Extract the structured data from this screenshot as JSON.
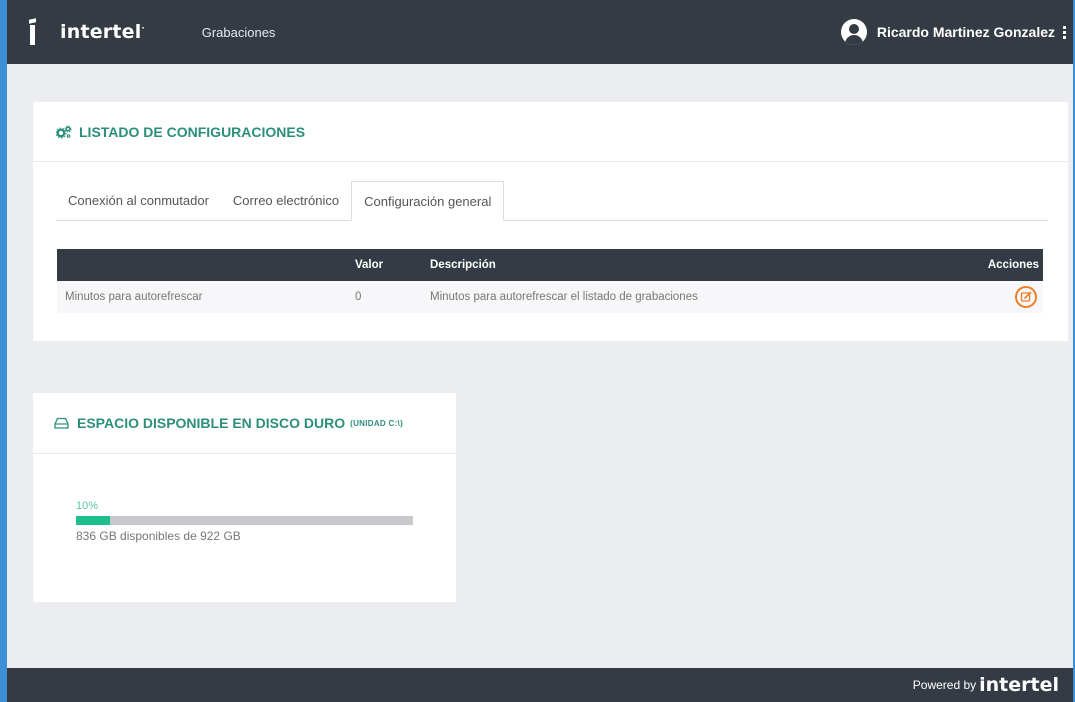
{
  "header": {
    "brand": "intertel",
    "nav_link": "Grabaciones",
    "user_name": "Ricardo Martinez Gonzalez"
  },
  "config_card": {
    "title": "LISTADO DE CONFIGURACIONES",
    "tabs": [
      {
        "label": "Conexión al conmutador",
        "active": false
      },
      {
        "label": "Correo electrónico",
        "active": false
      },
      {
        "label": "Configuración general",
        "active": true
      }
    ],
    "table": {
      "headers": [
        "",
        "Valor",
        "Descripción",
        "Acciones"
      ],
      "rows": [
        {
          "name": "Minutos para autorefrescar",
          "value": "0",
          "description": "Minutos para autorefrescar el listado de grabaciones"
        }
      ]
    }
  },
  "disk_card": {
    "title": "ESPACIO DISPONIBLE EN DISCO DURO",
    "unit_label": "(UNIDAD C:\\)",
    "percent_label": "10%",
    "percent_used": 0.1,
    "availability_text": "836 GB disponibles de 922 GB"
  },
  "footer": {
    "powered_by": "Powered by",
    "brand": "intertel"
  },
  "colors": {
    "header_bg": "#353b45",
    "accent_green": "#2c8f7c",
    "progress_fill": "#1dbf8c",
    "edit_orange": "#ee7d28",
    "window_border": "#3d8fd6"
  },
  "icons": [
    "intertel-logo-icon",
    "user-avatar-icon",
    "kebab-menu-icon",
    "gears-icon",
    "edit-icon",
    "hard-drive-icon"
  ]
}
